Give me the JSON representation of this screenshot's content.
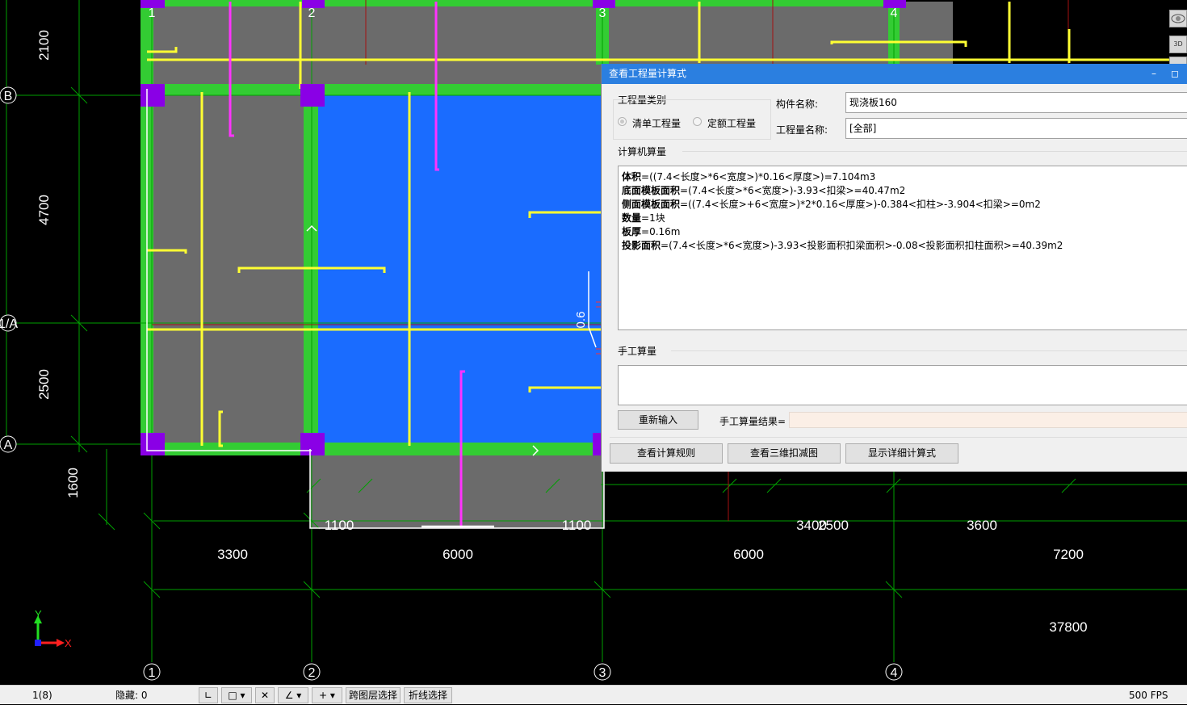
{
  "drawing": {
    "axis_labels_top": [
      "1",
      "2",
      "3",
      "4"
    ],
    "axis_labels_bottom": [
      "1",
      "2",
      "3",
      "4"
    ],
    "axis_labels_left": [
      "B",
      "1/A",
      "A"
    ],
    "dims_left": [
      "2100",
      "4700",
      "2500",
      "1600"
    ],
    "dims_row1": [
      "1100",
      "1100",
      "3400",
      "2500",
      "3600"
    ],
    "dims_row2": [
      "3300",
      "6000",
      "6000",
      "7200"
    ],
    "dims_total": "37800",
    "slope_label": "0.6",
    "ucs_x": "X",
    "ucs_y": "Y",
    "colors": {
      "beam_green": "#33cc33",
      "slab_selected": "#1a6cff",
      "slab_gray": "#6b6b6b",
      "column": "#8a00e6",
      "rebar_yellow": "#ffff33",
      "rebar_magenta": "#ff33ff",
      "axis_grid": "#00aa00"
    }
  },
  "dialog": {
    "title": "查看工程量计算式",
    "minimize_icon": "minimize-icon",
    "maximize_icon": "maximize-icon",
    "quantity_type_group": "工程量类别",
    "radio_bill": "清单工程量",
    "radio_quota": "定额工程量",
    "component_name_label": "构件名称:",
    "component_name_value": "现浇板160",
    "quantity_name_label": "工程量名称:",
    "quantity_name_value": "[全部]",
    "computer_calc_label": "计算机算量",
    "formulas": [
      {
        "name": "体积",
        "expr": "=((7.4<长度>*6<宽度>)*0.16<厚度>)=7.104m3"
      },
      {
        "name": "底面模板面积",
        "expr": "=(7.4<长度>*6<宽度>)-3.93<扣梁>=40.47m2"
      },
      {
        "name": "侧面模板面积",
        "expr": "=((7.4<长度>+6<宽度>)*2*0.16<厚度>)-0.384<扣柱>-3.904<扣梁>=0m2"
      },
      {
        "name": "数量",
        "expr": "=1块"
      },
      {
        "name": "板厚",
        "expr": "=0.16m"
      },
      {
        "name": "投影面积",
        "expr": "=(7.4<长度>*6<宽度>)-3.93<投影面积扣梁面积>-0.08<投影面积扣柱面积>=40.39m2"
      }
    ],
    "manual_calc_label": "手工算量",
    "reinput_button": "重新输入",
    "manual_result_label": "手工算量结果=",
    "manual_result_value": "",
    "view_rules_button": "查看计算规则",
    "view_3d_button": "查看三维扣减图",
    "show_detail_button": "显示详细计算式"
  },
  "right_toolbar": {
    "view3d_label": "3D"
  },
  "status_bar": {
    "selection_count": "1(8)",
    "hidden_label": "隐藏: 0",
    "cross_layer_select": "跨图层选择",
    "polyline_select": "折线选择",
    "fps": "500 FPS"
  }
}
